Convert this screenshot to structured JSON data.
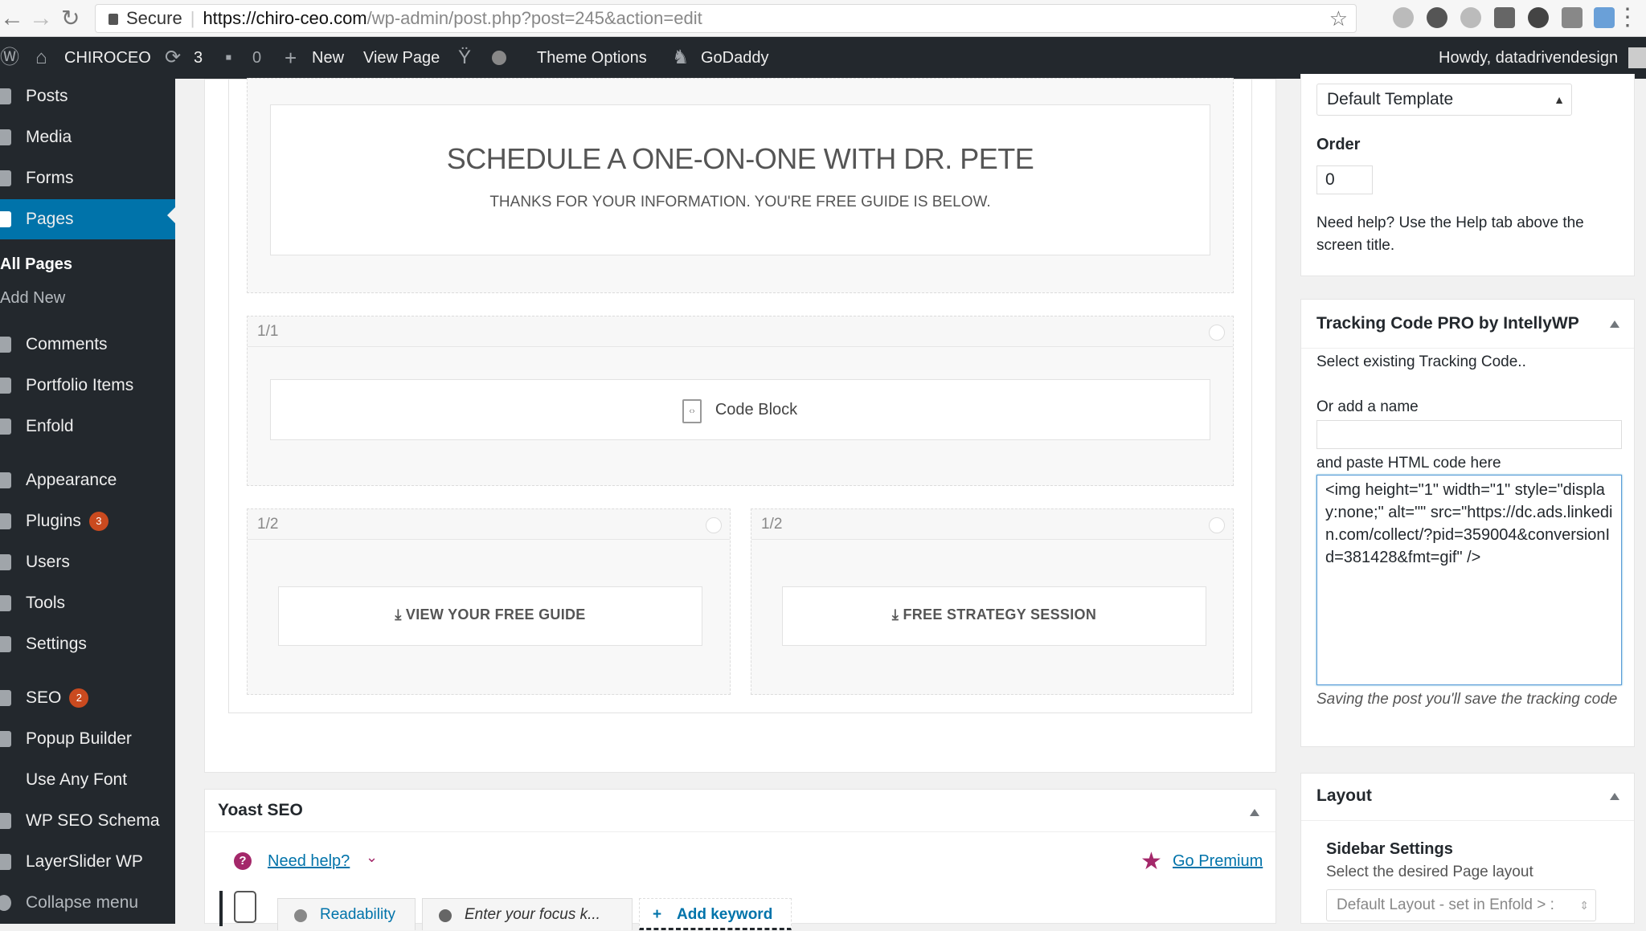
{
  "browser": {
    "secure_label": "Secure",
    "url_host": "https://chiro-ceo.com",
    "url_path": "/wp-admin/post.php?post=245&action=edit"
  },
  "adminbar": {
    "site_name": "CHIROCEO",
    "updates_count": "3",
    "comments_count": "0",
    "new_label": "New",
    "view_page_label": "View Page",
    "theme_options_label": "Theme Options",
    "godaddy_label": "GoDaddy",
    "howdy": "Howdy, datadrivendesign"
  },
  "sidebar": {
    "posts": "Posts",
    "media": "Media",
    "forms": "Forms",
    "pages": "Pages",
    "all_pages": "All Pages",
    "add_new": "Add New",
    "comments": "Comments",
    "portfolio": "Portfolio Items",
    "enfold": "Enfold",
    "appearance": "Appearance",
    "plugins": "Plugins",
    "plugins_badge": "3",
    "users": "Users",
    "tools": "Tools",
    "settings": "Settings",
    "seo": "SEO",
    "seo_badge": "2",
    "popup": "Popup Builder",
    "anyfont": "Use Any Font",
    "schema": "WP SEO Schema",
    "layerslider": "LayerSlider WP",
    "collapse": "Collapse menu"
  },
  "builder": {
    "headline": "SCHEDULE A ONE-ON-ONE WITH DR. PETE",
    "subheadline": "THANKS FOR YOUR INFORMATION. YOU'RE FREE GUIDE IS BELOW.",
    "full_width_label": "1/1",
    "code_block_label": "Code Block",
    "half_label_left": "1/2",
    "half_label_right": "1/2",
    "btn_guide": "VIEW YOUR FREE GUIDE",
    "btn_strategy": "FREE STRATEGY SESSION"
  },
  "yoast": {
    "title": "Yoast SEO",
    "need_help": "Need help?",
    "go_premium": "Go Premium",
    "tab_readability": "Readability",
    "focus_placeholder": "Enter your focus k...",
    "add_keyword": "Add keyword"
  },
  "page_attributes": {
    "template_value": "Default Template",
    "order_label": "Order",
    "order_value": "0",
    "help_text": "Need help? Use the Help tab above the screen title."
  },
  "tracking": {
    "title": "Tracking Code PRO by IntellyWP",
    "select_existing": "Select existing Tracking Code..",
    "or_add_name": "Or add a name",
    "name_value": "",
    "paste_label": "and paste HTML code here",
    "code_value": "<img height=\"1\" width=\"1\" style=\"display:none;\" alt=\"\" src=\"https://dc.ads.linkedin.com/collect/?pid=359004&conversionId=381428&fmt=gif\" />",
    "save_note": "Saving the post you'll save the tracking code"
  },
  "layout_box": {
    "title": "Layout",
    "sidebar_settings": "Sidebar Settings",
    "select_desc": "Select the desired Page layout",
    "layout_value": "Default Layout - set in Enfold > :"
  },
  "colors": {
    "admin_bg": "#23282d",
    "accent": "#0073aa",
    "badge": "#ca4a1f"
  }
}
